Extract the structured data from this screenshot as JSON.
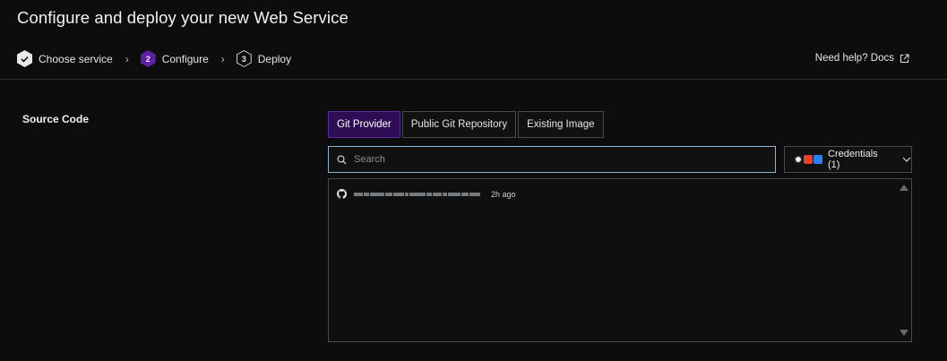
{
  "page": {
    "title": "Configure and deploy your new Web Service"
  },
  "stepper": {
    "steps": [
      {
        "number": "1",
        "label": "Choose service",
        "state": "done"
      },
      {
        "number": "2",
        "label": "Configure",
        "state": "active"
      },
      {
        "number": "3",
        "label": "Deploy",
        "state": "todo"
      }
    ]
  },
  "help": {
    "label": "Need help? Docs"
  },
  "source_code": {
    "label": "Source Code",
    "tabs": [
      {
        "label": "Git Provider",
        "selected": true
      },
      {
        "label": "Public Git Repository",
        "selected": false
      },
      {
        "label": "Existing Image",
        "selected": false
      }
    ],
    "search": {
      "placeholder": "Search",
      "value": ""
    },
    "credentials": {
      "label": "Credentials (1)"
    },
    "repos": [
      {
        "icon": "github-icon",
        "name_redacted": true,
        "updated": "2h ago"
      }
    ]
  },
  "colors": {
    "accent": "#5b1fa8",
    "background": "#0d0d0d",
    "focus_border": "#8fb3d6"
  }
}
